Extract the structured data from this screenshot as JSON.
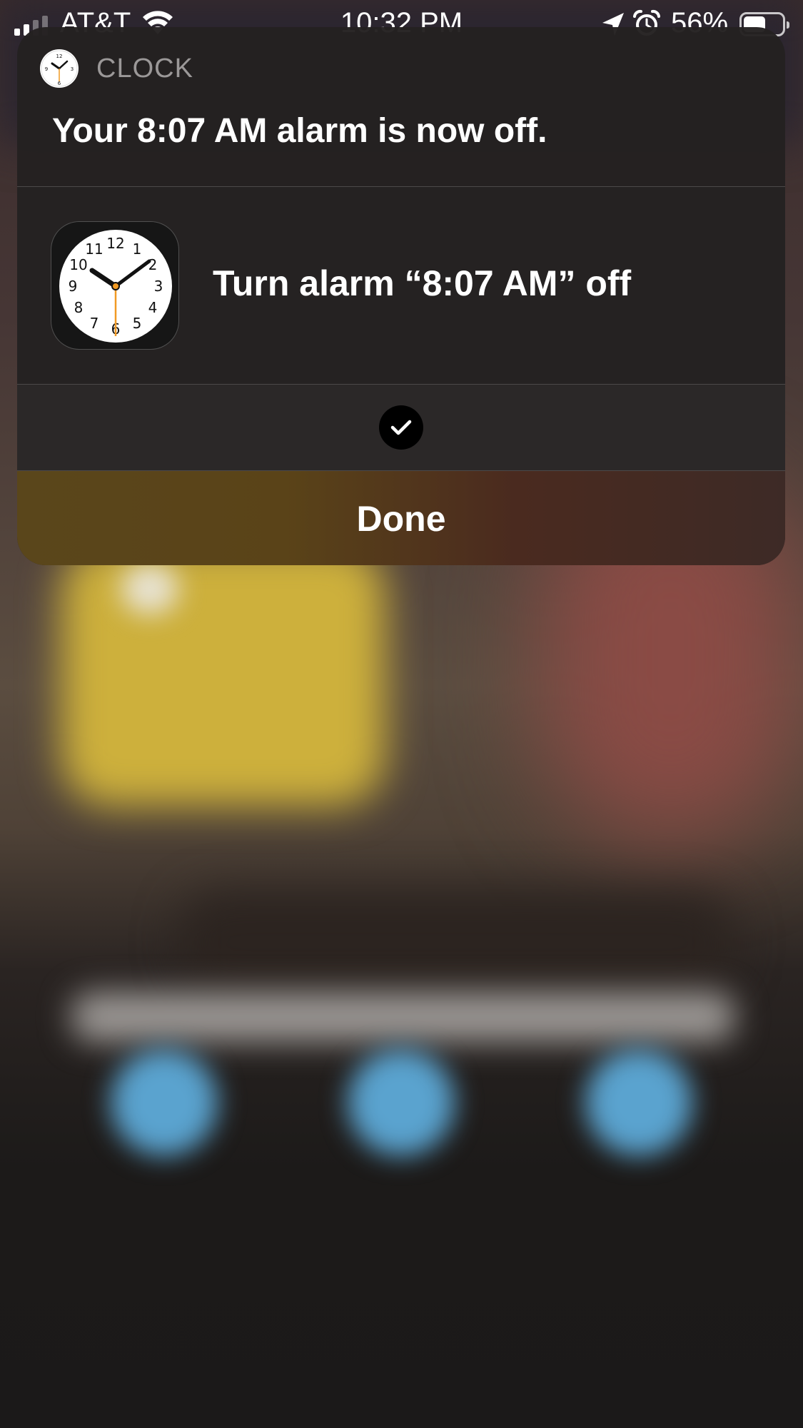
{
  "status_bar": {
    "carrier": "AT&T",
    "time": "10:32 PM",
    "battery_percent": "56%",
    "battery_level": 0.56,
    "signal_bars": 2,
    "icons": [
      "signal-icon",
      "wifi-icon",
      "location-arrow-icon",
      "alarm-clock-icon",
      "battery-icon"
    ]
  },
  "notification": {
    "app_name": "CLOCK",
    "message": "Your 8:07 AM alarm is now off.",
    "intent_label": "Turn alarm “8:07 AM” off",
    "confirmation_icon": "checkmark-icon",
    "done_label": "Done"
  },
  "clock_icon": {
    "numerals": [
      "12",
      "1",
      "2",
      "3",
      "4",
      "5",
      "6",
      "7",
      "8",
      "9",
      "10",
      "11"
    ]
  },
  "colors": {
    "card_background": "#242121",
    "done_gradient_left": "#5a461b",
    "done_gradient_right": "#3d2a26",
    "second_hand": "#f19a24",
    "app_name_gray": "#9b9898"
  }
}
